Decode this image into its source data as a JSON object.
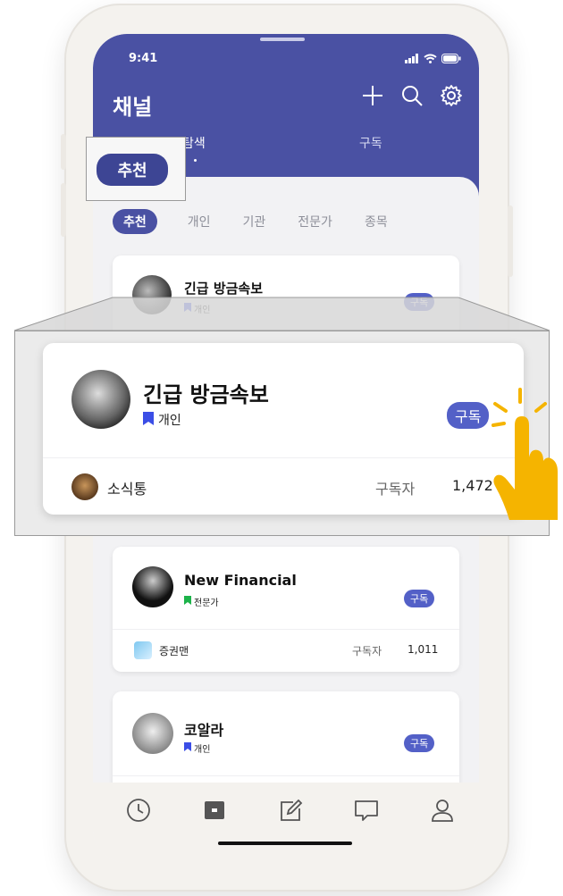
{
  "status_bar": {
    "time": "9:41"
  },
  "header": {
    "title": "채널",
    "tabs": [
      {
        "label": "탐색"
      },
      {
        "label": "구독"
      }
    ]
  },
  "callout": {
    "label": "추천"
  },
  "chips": [
    {
      "label": "추천",
      "active": true
    },
    {
      "label": "개인"
    },
    {
      "label": "기관"
    },
    {
      "label": "전문가"
    },
    {
      "label": "종목"
    }
  ],
  "cards": [
    {
      "title": "긴급 방금속보",
      "tag": "개인",
      "tag_color": "#3b4ee6",
      "subscribe_label": "구독"
    },
    {
      "title": "New Financial",
      "tag": "전문가",
      "tag_color": "#1db34a",
      "subscribe_label": "구독",
      "owner": "증권맨",
      "subscribers_label": "구독자",
      "subscribers": "1,011"
    },
    {
      "title": "코알라",
      "tag": "개인",
      "tag_color": "#3b4ee6",
      "subscribe_label": "구독"
    }
  ],
  "zoom_card": {
    "title": "긴급 방금속보",
    "tag": "개인",
    "subscribe_label": "구독",
    "owner": "소식통",
    "subscribers_label": "구독자",
    "subscribers": "1,472"
  },
  "bottom_nav": [
    {
      "icon": "clock-icon"
    },
    {
      "icon": "channel-icon"
    },
    {
      "icon": "edit-icon"
    },
    {
      "icon": "chat-icon"
    },
    {
      "icon": "profile-icon"
    }
  ],
  "colors": {
    "brand": "#4a51a3",
    "button": "#5360c7",
    "hand": "#f5b400"
  }
}
